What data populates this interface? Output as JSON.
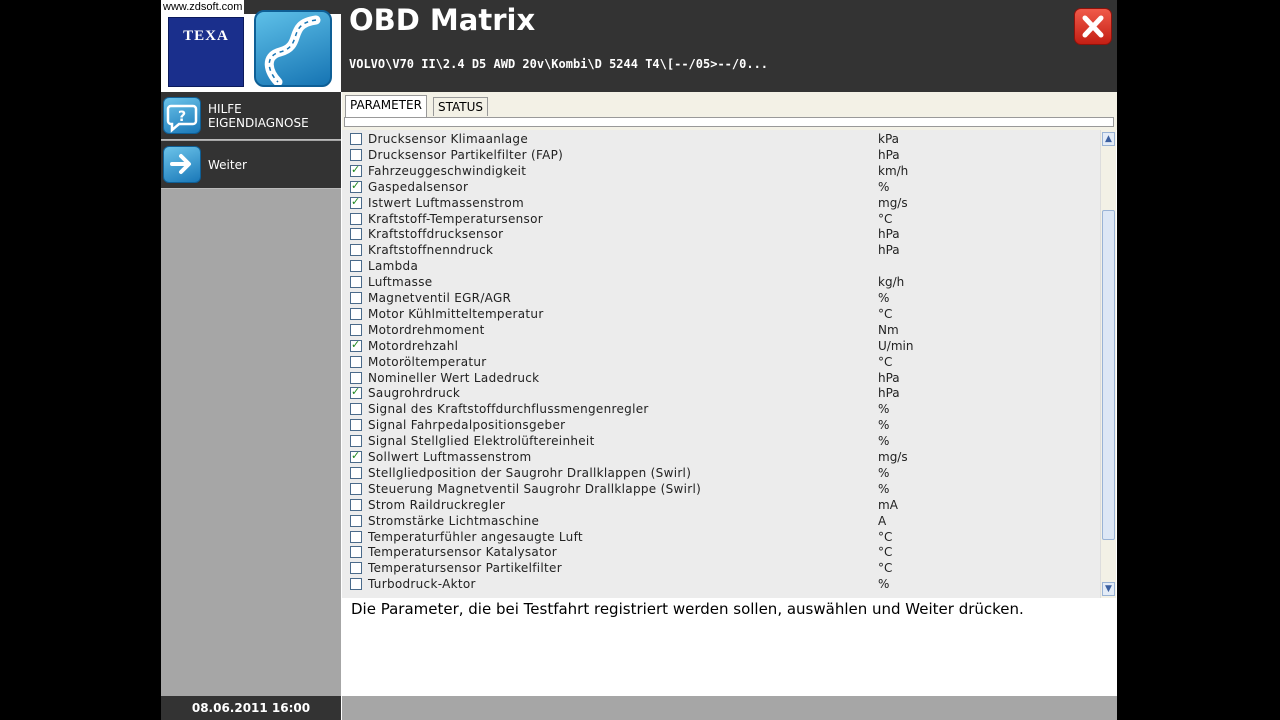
{
  "watermark": "www.zdsoft.com",
  "logo": {
    "brand": "TEXA"
  },
  "header": {
    "title": "OBD Matrix",
    "vehicle": "VOLVO\\V70 II\\2.4 D5 AWD 20v\\Kombi\\D 5244 T4\\[--/05>--/0..."
  },
  "sidebar": {
    "help_line1": "HILFE",
    "help_line2": "EIGENDIAGNOSE",
    "next_label": "Weiter",
    "datetime": "08.06.2011  16:00"
  },
  "tabs": [
    {
      "label": "PARAMETER",
      "active": true
    },
    {
      "label": "STATUS",
      "active": false
    }
  ],
  "parameters": [
    {
      "name": "Drucksensor Klimaanlage",
      "unit": "kPa",
      "checked": false
    },
    {
      "name": "Drucksensor Partikelfilter (FAP)",
      "unit": "hPa",
      "checked": false
    },
    {
      "name": "Fahrzeuggeschwindigkeit",
      "unit": "km/h",
      "checked": true
    },
    {
      "name": "Gaspedalsensor",
      "unit": "%",
      "checked": true
    },
    {
      "name": "Istwert Luftmassenstrom",
      "unit": "mg/s",
      "checked": true
    },
    {
      "name": "Kraftstoff-Temperatursensor",
      "unit": "°C",
      "checked": false
    },
    {
      "name": "Kraftstoffdrucksensor",
      "unit": "hPa",
      "checked": false
    },
    {
      "name": "Kraftstoffnenndruck",
      "unit": "hPa",
      "checked": false
    },
    {
      "name": "Lambda",
      "unit": "",
      "checked": false
    },
    {
      "name": "Luftmasse",
      "unit": "kg/h",
      "checked": false
    },
    {
      "name": "Magnetventil EGR/AGR",
      "unit": "%",
      "checked": false
    },
    {
      "name": "Motor Kühlmitteltemperatur",
      "unit": "°C",
      "checked": false
    },
    {
      "name": "Motordrehmoment",
      "unit": "Nm",
      "checked": false
    },
    {
      "name": "Motordrehzahl",
      "unit": "U/min",
      "checked": true
    },
    {
      "name": "Motoröltemperatur",
      "unit": "°C",
      "checked": false
    },
    {
      "name": "Nomineller Wert Ladedruck",
      "unit": "hPa",
      "checked": false
    },
    {
      "name": "Saugrohrdruck",
      "unit": "hPa",
      "checked": true
    },
    {
      "name": "Signal des Kraftstoffdurchflussmengenregler",
      "unit": "%",
      "checked": false
    },
    {
      "name": "Signal Fahrpedalpositionsgeber",
      "unit": "%",
      "checked": false
    },
    {
      "name": "Signal Stellglied Elektrolüftereinheit",
      "unit": "%",
      "checked": false
    },
    {
      "name": "Sollwert Luftmassenstrom",
      "unit": "mg/s",
      "checked": true
    },
    {
      "name": "Stellgliedposition der Saugrohr Drallklappen (Swirl)",
      "unit": "%",
      "checked": false
    },
    {
      "name": "Steuerung Magnetventil Saugrohr Drallklappe (Swirl)",
      "unit": "%",
      "checked": false
    },
    {
      "name": "Strom Raildruckregler",
      "unit": "mA",
      "checked": false
    },
    {
      "name": "Stromstärke Lichtmaschine",
      "unit": "A",
      "checked": false
    },
    {
      "name": "Temperaturfühler angesaugte Luft",
      "unit": "°C",
      "checked": false
    },
    {
      "name": "Temperatursensor Katalysator",
      "unit": "°C",
      "checked": false
    },
    {
      "name": "Temperatursensor Partikelfilter",
      "unit": "°C",
      "checked": false
    },
    {
      "name": "Turbodruck-Aktor",
      "unit": "%",
      "checked": false
    }
  ],
  "hint": "Die Parameter, die bei Testfahrt registriert werden sollen, auswählen und Weiter drücken."
}
